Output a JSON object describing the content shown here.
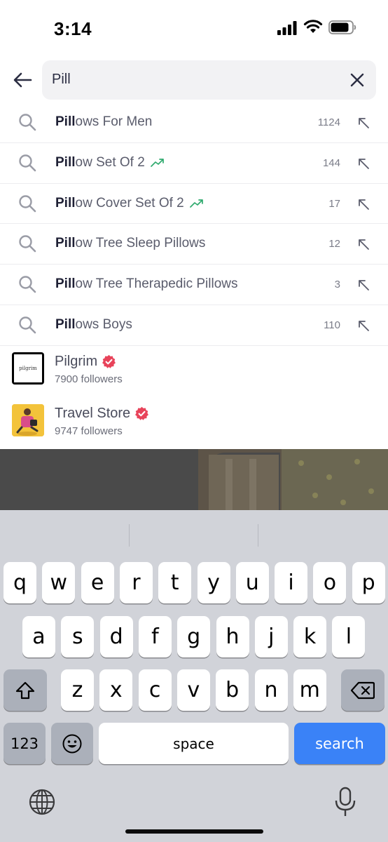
{
  "status_bar": {
    "time": "3:14"
  },
  "search": {
    "query": "Pill"
  },
  "suggestions": [
    {
      "bold": "Pill",
      "rest": "ows For Men",
      "count": "1124",
      "trending": false
    },
    {
      "bold": "Pill",
      "rest": "ow Set Of 2",
      "count": "144",
      "trending": true
    },
    {
      "bold": "Pill",
      "rest": "ow Cover Set Of 2",
      "count": "17",
      "trending": true
    },
    {
      "bold": "Pill",
      "rest": "ow Tree Sleep Pillows",
      "count": "12",
      "trending": false
    },
    {
      "bold": "Pill",
      "rest": "ow Tree Therapedic Pillows",
      "count": "3",
      "trending": false
    },
    {
      "bold": "Pill",
      "rest": "ows Boys",
      "count": "110",
      "trending": false
    }
  ],
  "stores": [
    {
      "name": "Pilgrim",
      "followers": "7900 followers",
      "logo_text": "pilgrim"
    },
    {
      "name": "Travel Store",
      "followers": "9747 followers"
    }
  ],
  "keyboard": {
    "row1": [
      "q",
      "w",
      "e",
      "r",
      "t",
      "y",
      "u",
      "i",
      "o",
      "p"
    ],
    "row2": [
      "a",
      "s",
      "d",
      "f",
      "g",
      "h",
      "j",
      "k",
      "l"
    ],
    "row3": [
      "z",
      "x",
      "c",
      "v",
      "b",
      "n",
      "m"
    ],
    "numbers_label": "123",
    "space_label": "space",
    "search_label": "search"
  },
  "colors": {
    "accent": "#3a82f7",
    "verified": "#e8435a",
    "trend": "#2faa6e"
  }
}
